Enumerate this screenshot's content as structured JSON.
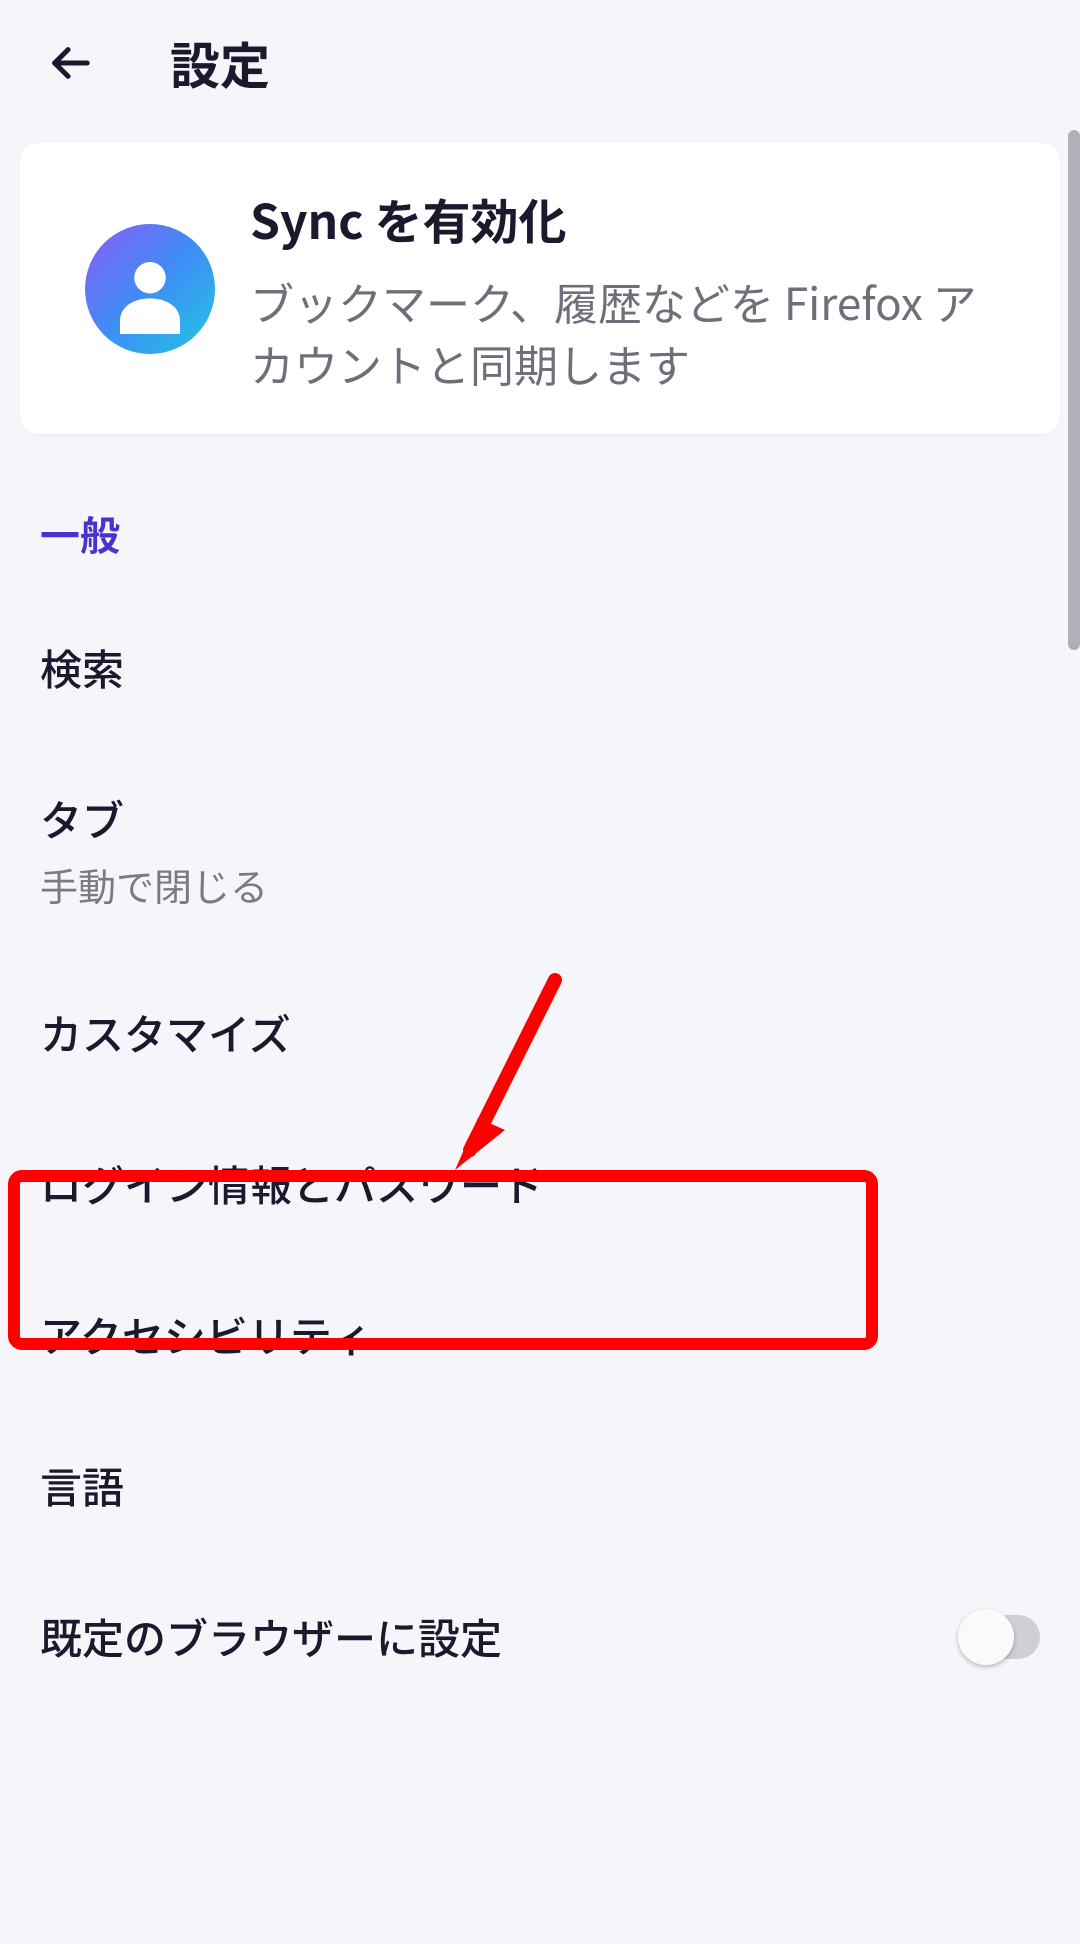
{
  "header": {
    "title": "設定"
  },
  "sync": {
    "title": "Sync を有効化",
    "description": "ブックマーク、履歴などを Firefox アカウントと同期します"
  },
  "section_heading": "一般",
  "items": {
    "search": {
      "title": "検索"
    },
    "tabs": {
      "title": "タブ",
      "subtitle": "手動で閉じる"
    },
    "customize": {
      "title": "カスタマイズ"
    },
    "logins": {
      "title": "ログイン情報とパスワード"
    },
    "accessibility": {
      "title": "アクセシビリティ"
    },
    "language": {
      "title": "言語"
    },
    "default_browser": {
      "title": "既定のブラウザーに設定"
    }
  },
  "annotation": {
    "highlight_target": "customize",
    "color": "#ff0000"
  },
  "icons": {
    "back": "arrow-left",
    "avatar": "user-circle"
  }
}
